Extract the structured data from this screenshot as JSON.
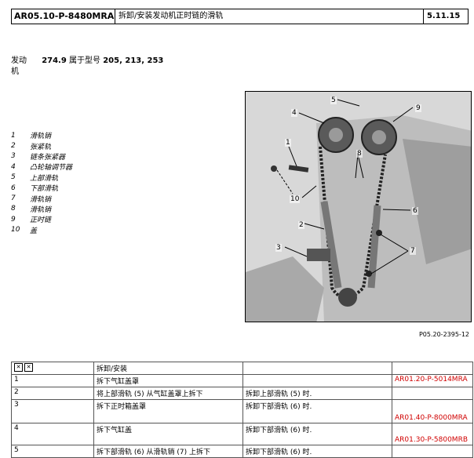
{
  "header": {
    "code": "AR05.10-P-8480MRA",
    "title": "拆卸/安装发动机正时链的滑轨",
    "date": "5.11.15"
  },
  "engine": {
    "label": "发动\n机",
    "label_line1": "发动",
    "label_line2": "机",
    "number": "274.9",
    "applies": "属于型号",
    "models": "205, 213, 253"
  },
  "legend": [
    {
      "num": "1",
      "text": "滑轨销"
    },
    {
      "num": "2",
      "text": "张紧轨"
    },
    {
      "num": "3",
      "text": "链条张紧器"
    },
    {
      "num": "4",
      "text": "凸轮轴调节器"
    },
    {
      "num": "5",
      "text": "上部滑轨"
    },
    {
      "num": "6",
      "text": "下部滑轨"
    },
    {
      "num": "7",
      "text": "滑轨销"
    },
    {
      "num": "8",
      "text": "滑轨销"
    },
    {
      "num": "9",
      "text": "正时链"
    },
    {
      "num": "10",
      "text": "盖"
    }
  ],
  "figure": {
    "callouts": [
      "5",
      "4",
      "9",
      "1",
      "8",
      "10",
      "6",
      "2",
      "3",
      "7"
    ],
    "caption": "P05.20-2395-12"
  },
  "table": {
    "header": {
      "col1": "",
      "col2": "拆卸/安装",
      "col3": "",
      "col4": ""
    },
    "rows": [
      {
        "n": "1",
        "c2": "拆下气缸盖罩",
        "c3": "",
        "c4": "AR01.20-P-5014MRA"
      },
      {
        "n": "2",
        "c2": "将上部滑轨 (5) 从气缸盖罩上拆下",
        "c3": "拆卸上部滑轨 (5) 时.",
        "c4": ""
      },
      {
        "n": "3",
        "c2": "拆下正时箱盖罩",
        "c3": "拆卸下部滑轨 (6) 时.",
        "c4": "AR01.40-P-8000MRA"
      },
      {
        "n": "4",
        "c2": "拆下气缸盖",
        "c3": "拆卸下部滑轨 (6) 时.",
        "c4": "AR01.30-P-5800MRB"
      },
      {
        "n": "5",
        "c2": "拆下部滑轨 (6) 从滑轨销 (7) 上拆下",
        "c3": "拆卸下部滑轨 (6) 时.",
        "c4": ""
      }
    ]
  }
}
